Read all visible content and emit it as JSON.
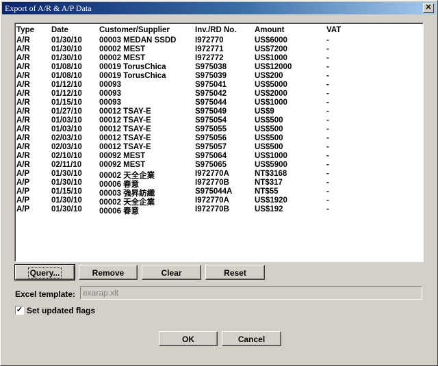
{
  "window": {
    "title": "Export of A/R & A/P Data",
    "close_glyph": "✕"
  },
  "list": {
    "headers": [
      "Type",
      "Date",
      "Customer/Supplier",
      "Inv./RD No.",
      "Amount",
      "VAT"
    ],
    "rows": [
      [
        "A/R",
        "01/30/10",
        "00003 MEDAN SSDD",
        "I972770",
        "US$6000",
        "-"
      ],
      [
        "A/R",
        "01/30/10",
        "00002 MEST",
        "I972771",
        "US$7200",
        "-"
      ],
      [
        "A/R",
        "01/30/10",
        "00002 MEST",
        "I972772",
        "US$1000",
        "-"
      ],
      [
        "A/R",
        "01/08/10",
        "00019 TorusChica",
        "S975038",
        "US$12000",
        "-"
      ],
      [
        "A/R",
        "01/08/10",
        "00019 TorusChica",
        "S975039",
        "US$200",
        "-"
      ],
      [
        "A/R",
        "01/12/10",
        "00093",
        "S975041",
        "US$5000",
        "-"
      ],
      [
        "A/R",
        "01/12/10",
        "00093",
        "S975042",
        "US$2000",
        "-"
      ],
      [
        "A/R",
        "01/15/10",
        "00093",
        "S975044",
        "US$1000",
        "-"
      ],
      [
        "A/R",
        "01/27/10",
        "00012 TSAY-E",
        "S975049",
        "US$9",
        "-"
      ],
      [
        "A/R",
        "01/03/10",
        "00012 TSAY-E",
        "S975054",
        "US$500",
        "-"
      ],
      [
        "A/R",
        "01/03/10",
        "00012 TSAY-E",
        "S975055",
        "US$500",
        "-"
      ],
      [
        "A/R",
        "02/03/10",
        "00012 TSAY-E",
        "S975056",
        "US$500",
        "-"
      ],
      [
        "A/R",
        "02/03/10",
        "00012 TSAY-E",
        "S975057",
        "US$500",
        "-"
      ],
      [
        "A/R",
        "02/10/10",
        "00092 MEST",
        "S975064",
        "US$1000",
        "-"
      ],
      [
        "A/R",
        "02/11/10",
        "00092 MEST",
        "S975065",
        "US$5900",
        "-"
      ],
      [
        "A/P",
        "01/30/10",
        "00002 天全企業",
        "I972770A",
        "NT$3168",
        "-"
      ],
      [
        "A/P",
        "01/30/10",
        "00006 春意",
        "I972770B",
        "NT$317",
        "-"
      ],
      [
        "A/P",
        "01/15/10",
        "00003 強昇紡織",
        "S975044A",
        "NT$55",
        "-"
      ],
      [
        "A/P",
        "01/30/10",
        "00002 天全企業",
        "I972770A",
        "US$1920",
        "-"
      ],
      [
        "A/P",
        "01/30/10",
        "00006 春意",
        "I972770B",
        "US$192",
        "-"
      ]
    ]
  },
  "buttons": {
    "query": "Query...",
    "remove": "Remove",
    "clear": "Clear",
    "reset": "Reset",
    "ok": "OK",
    "cancel": "Cancel"
  },
  "excel_template": {
    "label": "Excel template:",
    "value": "exarap.xlt"
  },
  "set_updated_flags": {
    "label": "Set updated flags",
    "checked": true,
    "check_glyph": "✓"
  }
}
